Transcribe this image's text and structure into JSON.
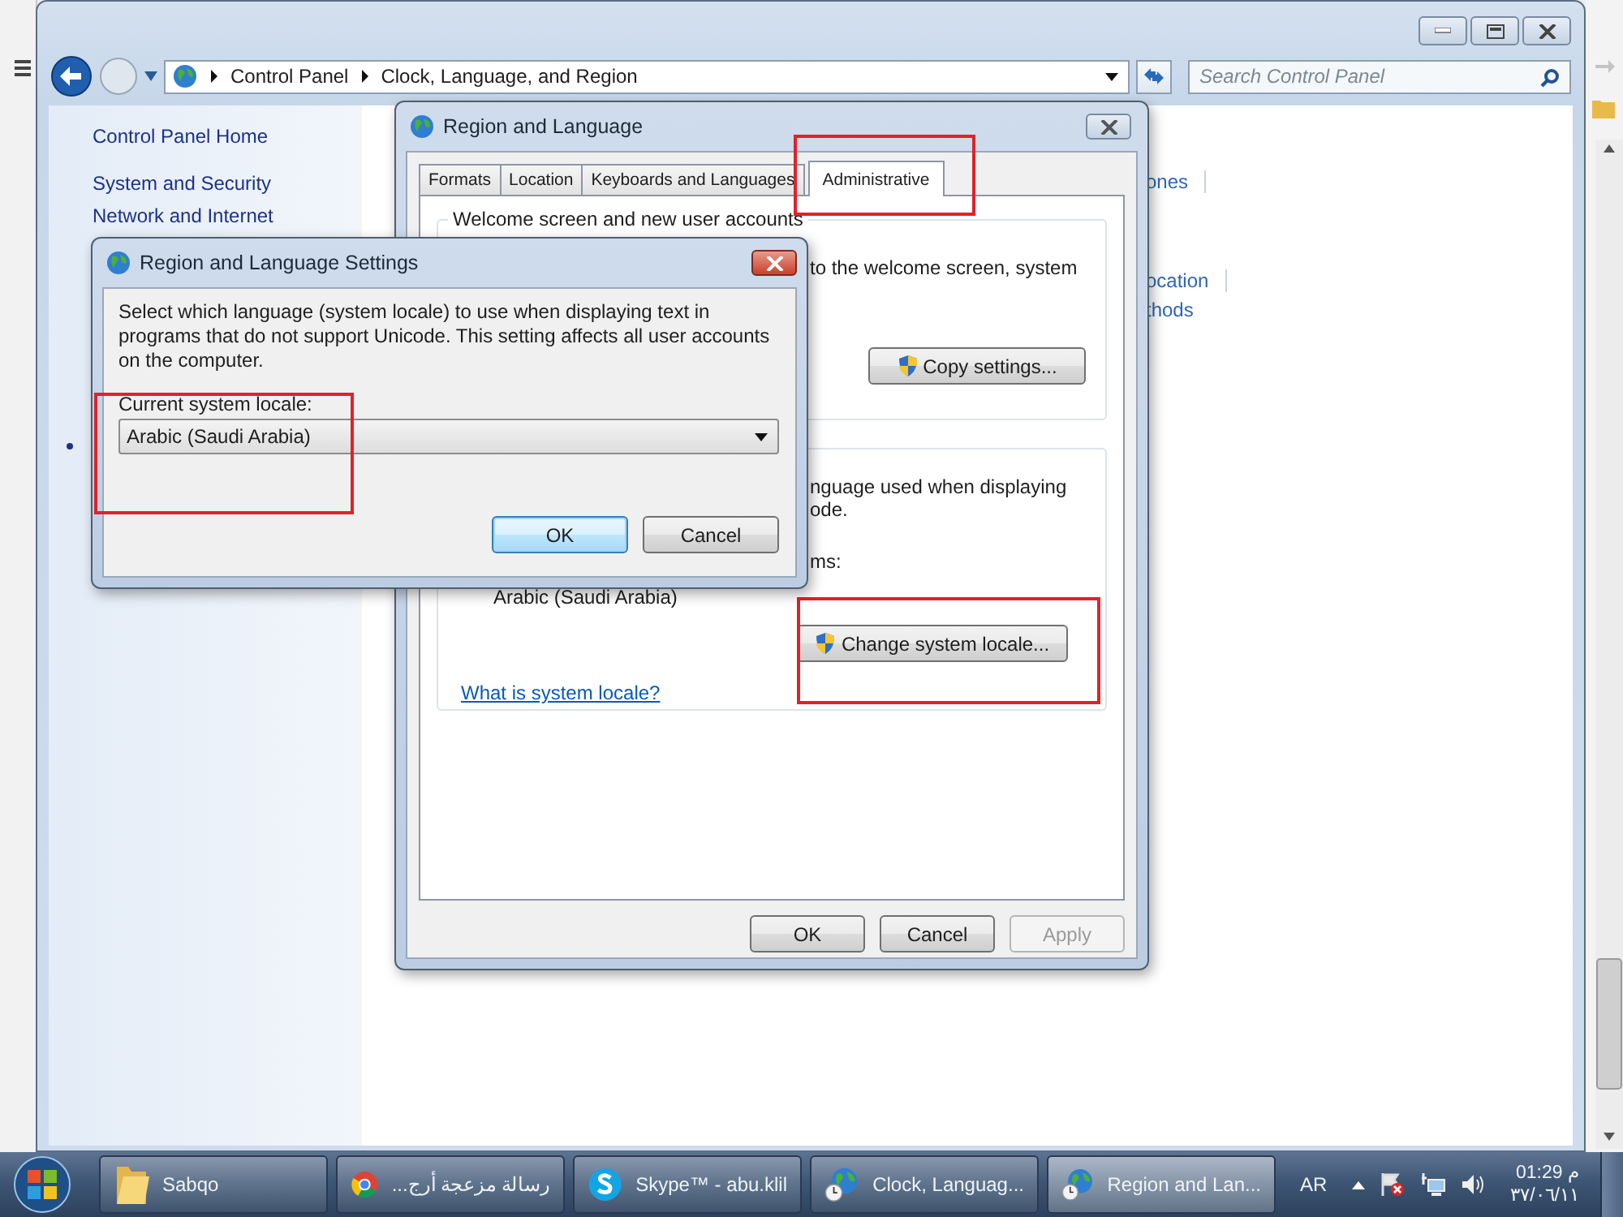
{
  "explorer": {
    "breadcrumb": [
      "Control Panel",
      "Clock, Language, and Region"
    ],
    "search": {
      "placeholder": "Search Control Panel"
    },
    "sidebar": {
      "items": [
        {
          "label": "Control Panel Home",
          "kind": "home"
        },
        {
          "label": "System and Security",
          "kind": "link"
        },
        {
          "label": "Network and Internet",
          "kind": "link"
        }
      ]
    },
    "content_fragments": [
      "ones",
      "ocation",
      "thods"
    ]
  },
  "region_dialog": {
    "title": "Region and Language",
    "tabs": [
      {
        "label": "Formats",
        "selected": false
      },
      {
        "label": "Location",
        "selected": false
      },
      {
        "label": "Keyboards and Languages",
        "selected": false
      },
      {
        "label": "Administrative",
        "selected": true
      }
    ],
    "welcome_group": {
      "title": "Welcome screen and new user accounts",
      "text_lines": [
        "to the welcome screen, system"
      ],
      "button": "Copy settings..."
    },
    "locale_group": {
      "text_lines": [
        "nguage used when displaying",
        "ode."
      ],
      "label": "ms:",
      "locale": "Arabic (Saudi Arabia)",
      "button": "Change system locale..."
    },
    "link": "What is system locale?",
    "buttons": [
      {
        "label": "OK",
        "disabled": false
      },
      {
        "label": "Cancel",
        "disabled": false
      },
      {
        "label": "Apply",
        "disabled": true
      }
    ]
  },
  "settings_dialog": {
    "title": "Region and Language Settings",
    "description": "Select which language (system locale) to use when displaying text in programs that do not support Unicode. This setting affects all user accounts on the computer.",
    "locale_label": "Current system locale:",
    "locale_value": "Arabic (Saudi Arabia)",
    "buttons": [
      {
        "label": "OK",
        "default": true
      },
      {
        "label": "Cancel",
        "default": false
      }
    ]
  },
  "taskbar": {
    "buttons": [
      {
        "label": "Sabqo",
        "kind": "folder",
        "selected": false
      },
      {
        "label": "رسالة مزعجة أرج...",
        "kind": "browser",
        "selected": false
      },
      {
        "label": "Skype™ - abu.klil",
        "kind": "skype",
        "selected": false
      },
      {
        "label": "Clock, Languag...",
        "kind": "globe",
        "selected": false
      },
      {
        "label": "Region and Lan...",
        "kind": "globe",
        "selected": true
      }
    ],
    "language": "AR",
    "clock": {
      "time": "01:29 م",
      "date": "٣٧/٠٦/١١"
    }
  }
}
